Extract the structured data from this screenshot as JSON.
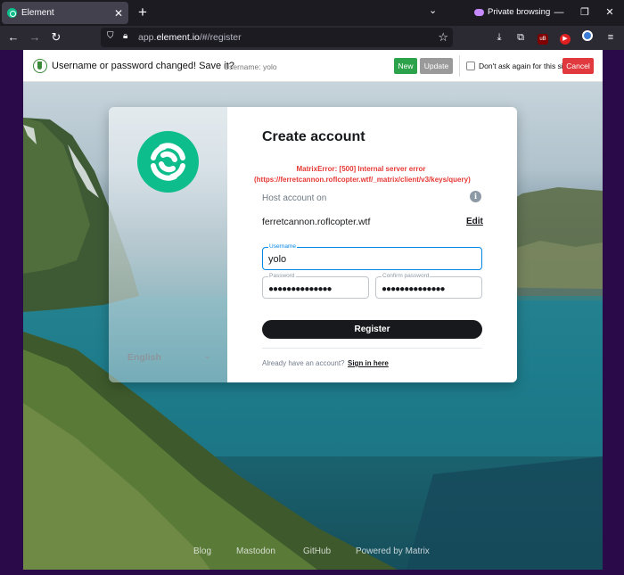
{
  "browser": {
    "tab_title": "Element",
    "tab_close": "✕",
    "new_tab": "+",
    "tabs_menu": "⌄",
    "private_label": "Private browsing",
    "url_prefix": "app.",
    "url_domain": "element.io",
    "url_suffix": "/#/register"
  },
  "save_prompt": {
    "message": "Username or password changed! Save it?",
    "username_label": "Username:",
    "username_value": "yolo",
    "new_label": "New",
    "update_label": "Update",
    "dont_ask_label": "Don't ask again for this site",
    "cancel_label": "Cancel"
  },
  "register": {
    "title": "Create account",
    "error": "MatrixError: [500] Internal server error (https://ferretcannon.roflcopter.wtf/_matrix/client/v3/keys/query)",
    "host_label": "Host account on",
    "host_value": "ferretcannon.roflcopter.wtf",
    "edit_label": "Edit",
    "username_label": "Username",
    "username_value": "yolo",
    "password_label": "Password",
    "password_value": "●●●●●●●●●●●●●●",
    "confirm_label": "Confirm password",
    "confirm_value": "●●●●●●●●●●●●●●",
    "register_label": "Register",
    "signin_question": "Already have an account?",
    "signin_link": "Sign in here",
    "language": "English"
  },
  "footer": {
    "blog": "Blog",
    "mastodon": "Mastodon",
    "github": "GitHub",
    "powered": "Powered by Matrix"
  },
  "colors": {
    "accent": "#0dbd8b",
    "error": "#e53935",
    "new_button": "#2ca34a",
    "cancel_button": "#e0393e"
  }
}
